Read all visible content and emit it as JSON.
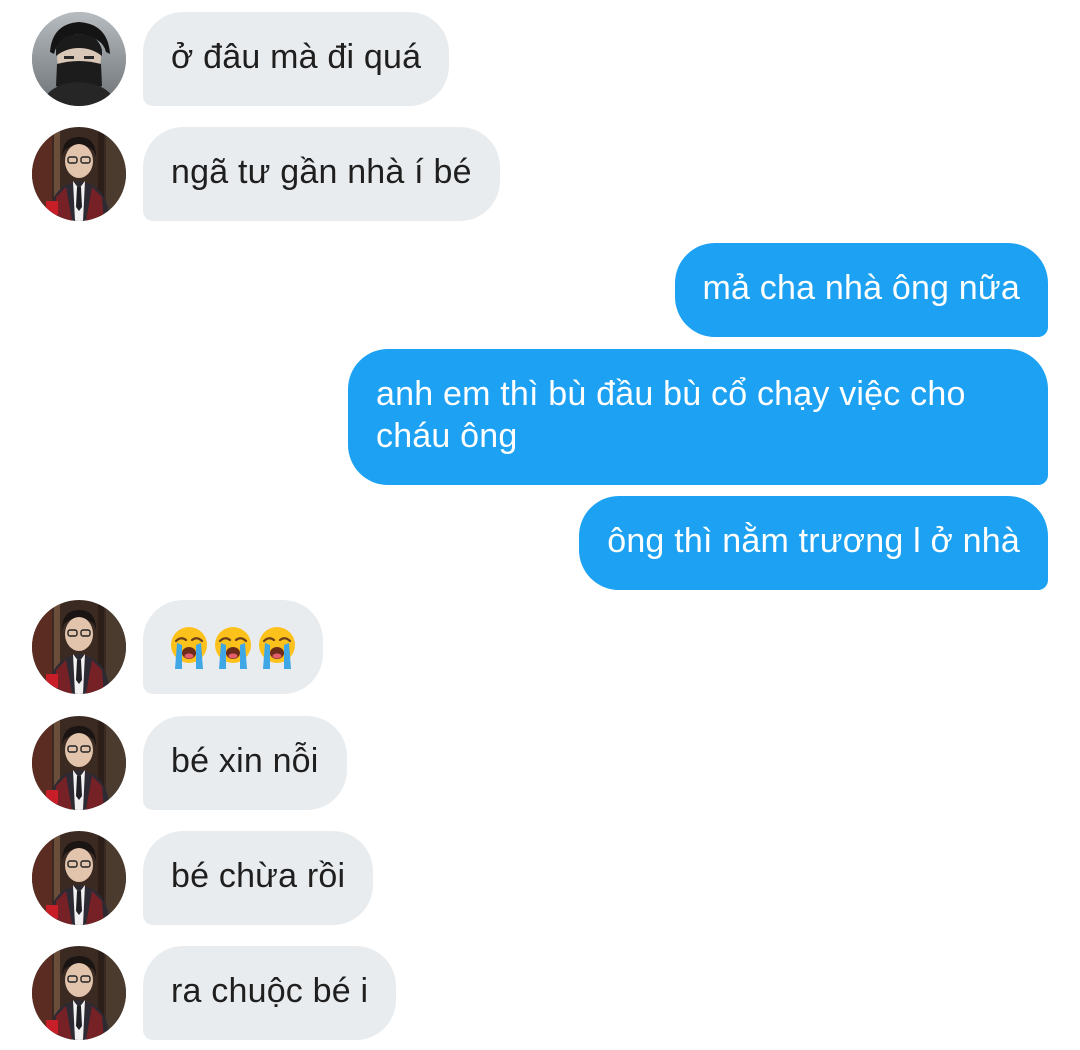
{
  "messages": [
    {
      "from": "other",
      "avatar": "avatar-masked-user",
      "text": "ở đâu mà đi quá"
    },
    {
      "from": "other",
      "avatar": "avatar-suit-user",
      "text": "ngã tư gần nhà í bé"
    },
    {
      "from": "me",
      "text": "mả cha nhà ông nữa"
    },
    {
      "from": "me",
      "text": "anh em thì bù đầu bù cổ chạy việc cho cháu ông"
    },
    {
      "from": "me",
      "text": "ông thì nằm trương l ở nhà"
    },
    {
      "from": "other",
      "avatar": "avatar-suit-user",
      "emoji": [
        "loudly-crying-face-icon",
        "loudly-crying-face-icon",
        "loudly-crying-face-icon"
      ]
    },
    {
      "from": "other",
      "avatar": "avatar-suit-user",
      "text": "bé xin nỗi"
    },
    {
      "from": "other",
      "avatar": "avatar-suit-user",
      "text": "bé chừa rồi"
    },
    {
      "from": "other",
      "avatar": "avatar-suit-user",
      "text": "ra chuộc bé i"
    }
  ],
  "colors": {
    "incoming_bubble": "#e9ecef",
    "outgoing_bubble": "#1da1f2",
    "incoming_text": "#1f1f1f",
    "outgoing_text": "#ffffff"
  }
}
